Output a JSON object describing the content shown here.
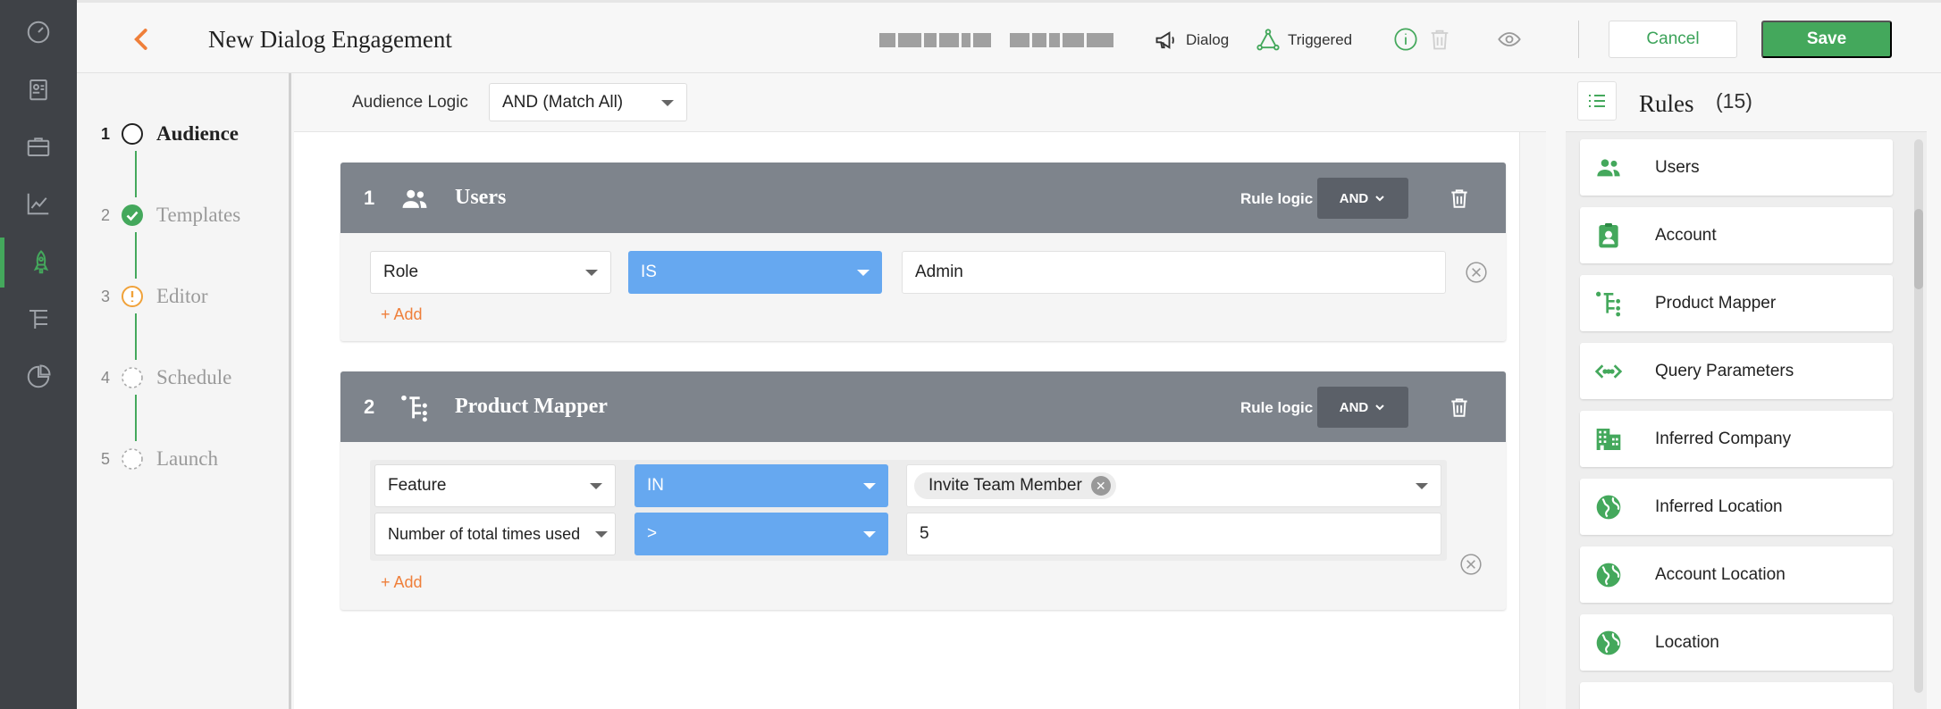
{
  "header": {
    "title": "New Dialog Engagement",
    "type_label": "Dialog",
    "trigger_label": "Triggered",
    "cancel_label": "Cancel",
    "save_label": "Save"
  },
  "steps": [
    {
      "num": "1",
      "label": "Audience"
    },
    {
      "num": "2",
      "label": "Templates"
    },
    {
      "num": "3",
      "label": "Editor"
    },
    {
      "num": "4",
      "label": "Schedule"
    },
    {
      "num": "5",
      "label": "Launch"
    }
  ],
  "audience": {
    "logic_label": "Audience Logic",
    "logic_value": "AND (Match All)"
  },
  "cards": [
    {
      "num": "1",
      "title": "Users",
      "rule_logic_label": "Rule logic",
      "rule_logic_value": "AND",
      "conditions": [
        {
          "field": "Role",
          "operator": "IS",
          "value": "Admin"
        }
      ],
      "add_label": "+ Add"
    },
    {
      "num": "2",
      "title": "Product Mapper",
      "rule_logic_label": "Rule logic",
      "rule_logic_value": "AND",
      "conditions": [
        {
          "field": "Feature",
          "operator": "IN",
          "value": "Invite Team Member"
        },
        {
          "field": "Number of total times used",
          "operator": ">",
          "value": "5"
        }
      ],
      "add_label": "+ Add"
    }
  ],
  "rules": {
    "title": "Rules",
    "count": "(15)",
    "items": [
      {
        "label": "Users",
        "icon": "users-icon"
      },
      {
        "label": "Account",
        "icon": "account-icon"
      },
      {
        "label": "Product Mapper",
        "icon": "product-mapper-icon"
      },
      {
        "label": "Query Parameters",
        "icon": "code-icon"
      },
      {
        "label": "Inferred Company",
        "icon": "building-icon"
      },
      {
        "label": "Inferred Location",
        "icon": "globe-icon"
      },
      {
        "label": "Account Location",
        "icon": "globe-icon"
      },
      {
        "label": "Location",
        "icon": "globe-icon"
      }
    ]
  },
  "colors": {
    "accent": "#44a85c",
    "orange": "#ef7f3a",
    "operator_blue": "#66a8f0",
    "card_header": "#7e848c",
    "rail": "#3f4247"
  }
}
